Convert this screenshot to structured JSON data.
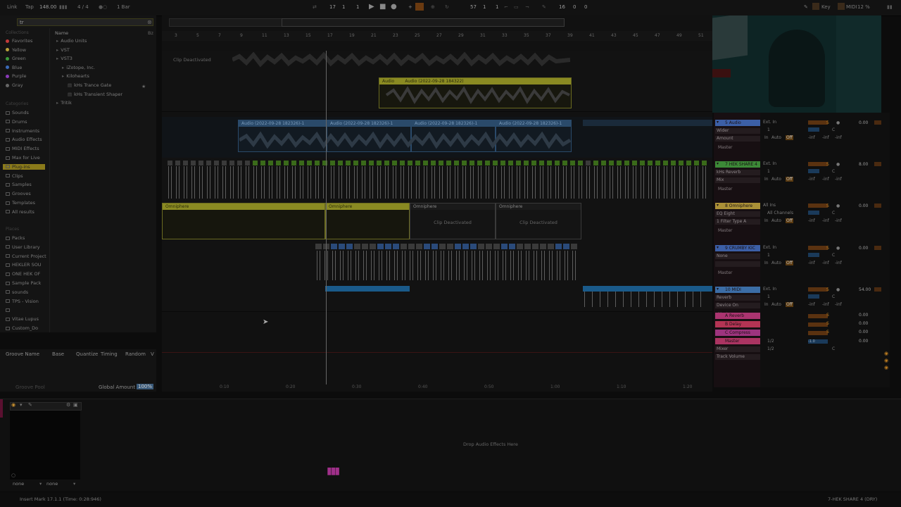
{
  "transport": {
    "link": "Link",
    "tap": "Tap",
    "tempo": "148.00",
    "signature": "4 / 4",
    "quantize": "1 Bar",
    "bar": "17",
    "beat": "1",
    "sixteenth": "1",
    "loop_start": "57",
    "loop_pos_a": "1",
    "loop_pos_b": "1",
    "loop_len": "16",
    "loop_len_b": "0",
    "loop_len_c": "0",
    "key_label": "Key",
    "midi_label": "MIDI",
    "cpu": "12 %",
    "w_label": "W"
  },
  "browser": {
    "search_value": "tr",
    "name_header": "Name",
    "collections_label": "Collections",
    "collections": [
      {
        "label": "Favorites",
        "color": "#c23a3a"
      },
      {
        "label": "Yellow",
        "color": "#b8a23a"
      },
      {
        "label": "Green",
        "color": "#3a9a3a"
      },
      {
        "label": "Blue",
        "color": "#3a6ab8"
      },
      {
        "label": "Purple",
        "color": "#8a3ab8"
      },
      {
        "label": "Gray",
        "color": "#666666"
      }
    ],
    "categories_label": "Categories",
    "categories": [
      "Sounds",
      "Drums",
      "Instruments",
      "Audio Effects",
      "MIDI Effects",
      "Max for Live",
      "Plug-ins",
      "Clips",
      "Samples",
      "Grooves",
      "Templates",
      "All results"
    ],
    "selected_category": "Plug-ins",
    "places_label": "Places",
    "places": [
      "Packs",
      "User Library",
      "Current Project",
      "HEKLER SOU",
      "ONE HEK OF",
      "Sample Pack",
      "sounds",
      "TPS - Vision",
      "",
      "Vitae Lupus",
      "Custom_Do"
    ],
    "tree": [
      {
        "label": "Audio Units",
        "indent": 0
      },
      {
        "label": "VST",
        "indent": 0
      },
      {
        "label": "VST3",
        "indent": 0
      },
      {
        "label": "iZotope, Inc.",
        "indent": 1
      },
      {
        "label": "Kilohearts",
        "indent": 1
      },
      {
        "label": "kHs Trance Gate",
        "indent": 2
      },
      {
        "label": "kHs Transient Shaper",
        "indent": 2
      },
      {
        "label": "Tritik",
        "indent": 0
      }
    ]
  },
  "groove": {
    "col_name": "Groove Name",
    "col_base": "Base",
    "col_quantize": "Quantize",
    "col_timing": "Timing",
    "col_random": "Random",
    "col_v": "V",
    "pool_label": "Groove Pool",
    "global_amount_label": "Global Amount",
    "global_amount_value": "100%"
  },
  "ruler": {
    "bars": [
      "3",
      "5",
      "7",
      "9",
      "11",
      "13",
      "15",
      "17",
      "19",
      "21",
      "23",
      "25",
      "27",
      "29",
      "31",
      "33",
      "35",
      "37",
      "39",
      "41",
      "43",
      "45",
      "47",
      "49",
      "51"
    ],
    "times": [
      "0:10",
      "0:20",
      "0:30",
      "0:40",
      "0:50",
      "1:00",
      "1:10",
      "1:20"
    ]
  },
  "arrangement": {
    "clip_deactivated": "Clip Deactivated",
    "audio_label": "Audio",
    "audio_clip_name": "Audio (2022-09-28 184322)",
    "audio_blue_clip_1": "Audio (2022-09-28 182326)-1",
    "audio_blue_clip_2": "Audio (2022-09-28 182326)-1",
    "audio_blue_clip_3": "Audio (2022-09-28 182326)-1",
    "audio_blue_clip_4": "Audio (2022-09-28 182326)-1",
    "omni_clip_1": "Omniphere",
    "omni_clip_2": "Omniphere",
    "omni_clip_3": "Omniphere",
    "omni_clip_4": "Omniphere",
    "omni_deactivated_1": "Clip Deactivated",
    "omni_deactivated_2": "Clip Deactivated"
  },
  "mixer": {
    "tracks": [
      {
        "name": "5 Audio",
        "color": "#3a6ab8",
        "input": "Ext. In",
        "ch": "1",
        "device1": "Wider",
        "device2": "Amount",
        "out": "Master",
        "vol": "0.00"
      },
      {
        "name": "7 HEK SHARE 4",
        "color": "#3a9a3a",
        "input": "Ext. In",
        "ch": "1",
        "device1": "kHs Reverb",
        "device2": "Mix",
        "out": "Master",
        "vol": "8.00"
      },
      {
        "name": "8 Omniphere",
        "color": "#b8a23a",
        "input": "All Ins",
        "ch": "All Channels",
        "device1": "EQ Eight",
        "device2": "1 Filter Type A",
        "out": "Master",
        "vol": "0.00"
      },
      {
        "name": "9 CRUMBY KIC",
        "color": "#3a6ab8",
        "input": "Ext. In",
        "ch": "1",
        "device1": "None",
        "device2": "",
        "out": "Master",
        "vol": "0.00"
      },
      {
        "name": "10 MIDI",
        "color": "#3a7ab8",
        "input": "Ext. In",
        "ch": "1",
        "device1": "Reverb",
        "device2": "Device On",
        "out": "Master",
        "vol": "54.00"
      }
    ],
    "returns": [
      {
        "name": "A Reverb",
        "color": "#b83a7a",
        "vol": "0.00"
      },
      {
        "name": "B Delay",
        "color": "#c23a5a",
        "vol": "0.00"
      },
      {
        "name": "C Compress",
        "color": "#a83a8a",
        "vol": "0.00"
      }
    ],
    "master": {
      "name": "Master",
      "device1": "Mixer",
      "device2": "Track Volume",
      "sel1": "1/2",
      "sel2": "1/2",
      "vol": "0.00",
      "peak": "-1.0"
    },
    "auto_label": "Auto",
    "in_label": "In",
    "off_label": "Off",
    "inf_label": "-inf"
  },
  "device": {
    "drop_text": "Drop Audio Effects Here",
    "sel_a": "none",
    "sel_b": "none"
  },
  "status": {
    "left_text": "Insert Mark 17.1.1 (Time: 0:28:946)",
    "right_text": "7-HEK SHARE 4 (DRY)"
  }
}
